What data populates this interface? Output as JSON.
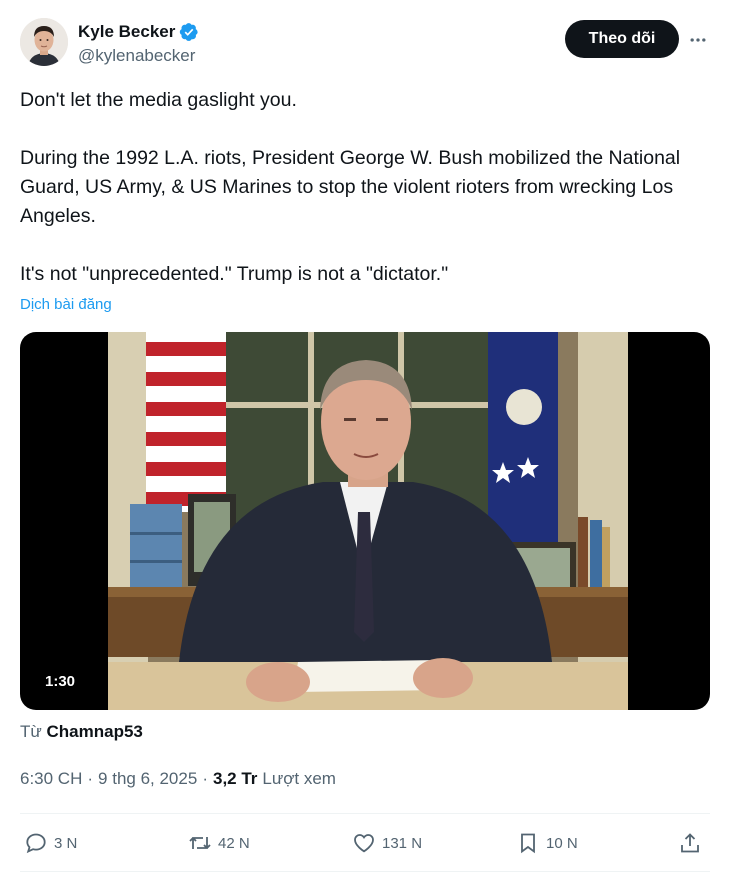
{
  "author": {
    "display_name": "Kyle Becker",
    "handle": "@kylenabecker",
    "verified": true
  },
  "header": {
    "follow_label": "Theo dõi",
    "more_icon": "more-horizontal-icon"
  },
  "tweet": {
    "paragraphs": [
      "Don't let the media gaslight you.",
      "During the 1992 L.A. riots, President George W. Bush mobilized the National Guard, US Army, & US Marines to stop the violent rioters from wrecking Los Angeles.",
      "It's not \"unprecedented.\" Trump is not a \"dictator.\""
    ],
    "translate_label": "Dịch bài đăng"
  },
  "media": {
    "type": "video",
    "duration": "1:30"
  },
  "source": {
    "prefix": "Từ",
    "name": "Chamnap53"
  },
  "meta": {
    "time": "6:30 CH",
    "date": "9 thg 6, 2025",
    "views_count": "3,2 Tr",
    "views_label": "Lượt xem"
  },
  "actions": {
    "replies": "3 N",
    "reposts": "42 N",
    "likes": "131 N",
    "bookmarks": "10 N"
  },
  "colors": {
    "accent": "#1d9bf0",
    "text_primary": "#0f1419",
    "text_secondary": "#536471",
    "follow_bg": "#0f1419"
  }
}
